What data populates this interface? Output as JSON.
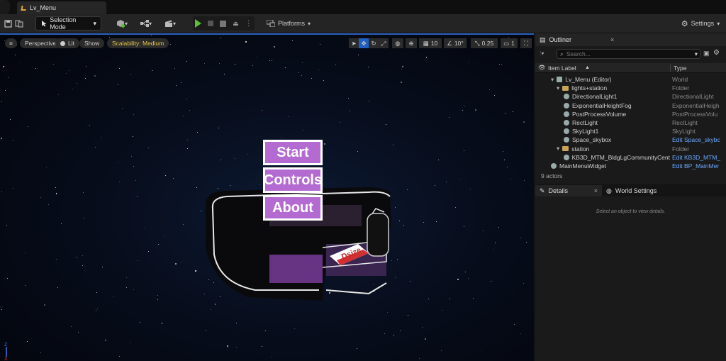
{
  "tabbar": {
    "level_tab": "Lv_Menu"
  },
  "toolbar": {
    "selection_mode": "Selection Mode",
    "platforms": "Platforms",
    "settings": "Settings"
  },
  "viewport": {
    "perspective": "Perspective",
    "lit": "Lit",
    "show": "Show",
    "scalability": "Scalability: Medium",
    "grid_snap": "10",
    "rot_snap": "10°",
    "scale_snap": "0.25",
    "camera_speed": "1",
    "menu": [
      "Start",
      "Controls",
      "About"
    ],
    "sign_text": "Dsize"
  },
  "outliner": {
    "tab": "Outliner",
    "search_placeholder": "Search...",
    "col_label": "Item Label",
    "col_type": "Type",
    "rows": [
      {
        "label": "Lv_Menu (Editor)",
        "type": "World"
      },
      {
        "label": "lights+station",
        "type": "Folder"
      },
      {
        "label": "DirectionalLight1",
        "type": "DirectionalLight"
      },
      {
        "label": "ExponentialHeightFog",
        "type": "ExponentialHeigh"
      },
      {
        "label": "PostProcessVolume",
        "type": "PostProcessVolu"
      },
      {
        "label": "RectLight",
        "type": "RectLight"
      },
      {
        "label": "SkyLight1",
        "type": "SkyLight"
      },
      {
        "label": "Space_skybox",
        "type": "Edit Space_skybc"
      },
      {
        "label": "station",
        "type": "Folder"
      },
      {
        "label": "KB3D_MTM_BldgLgCommunityCent",
        "type": "Edit KB3D_MTM_"
      },
      {
        "label": "MainMenuWidget",
        "type": "Edit BP_MainMer"
      }
    ],
    "actors": "9 actors"
  },
  "details": {
    "tab": "Details",
    "world_settings": "World Settings",
    "hint": "Select an object to view details."
  },
  "colors": {
    "accent": "#2a60c0",
    "menu_purple": "#b36bd1",
    "scalability": "#e7c64a",
    "play": "#5bbf3a"
  }
}
